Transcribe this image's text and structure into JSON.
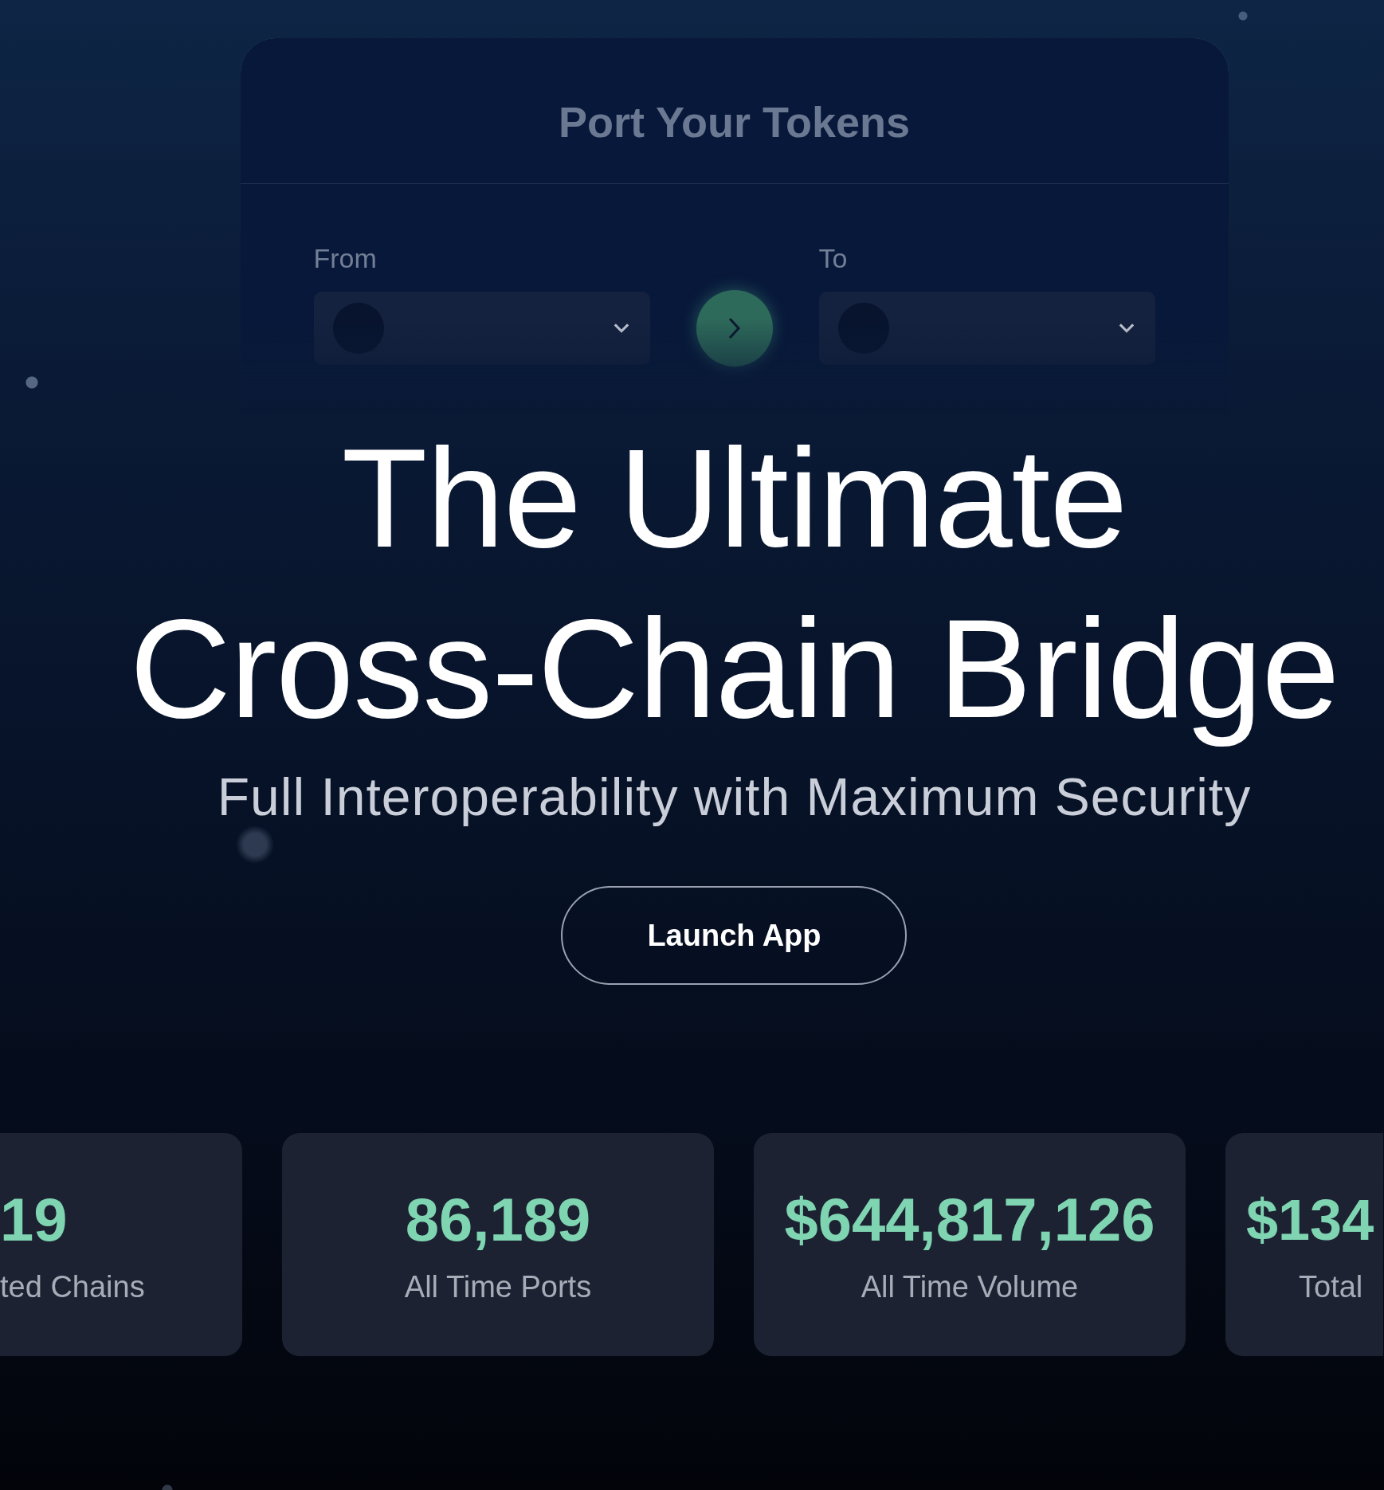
{
  "bridge_widget": {
    "title": "Port Your Tokens",
    "from_label": "From",
    "to_label": "To"
  },
  "hero": {
    "title_lines": [
      "The Ultimate",
      "Cross-Chain Bridge"
    ],
    "subtitle": "Full Interoperability with Maximum Security",
    "button": "Launch App"
  },
  "stats": [
    {
      "kind": "left-edge",
      "value": "19",
      "label": "ted Chains"
    },
    {
      "kind": "full",
      "value": "86,189",
      "label": "All Time Ports"
    },
    {
      "kind": "full",
      "value": "$644,817,126",
      "label": "All Time Volume"
    },
    {
      "kind": "right-edge",
      "value": "$134",
      "label": "Total"
    }
  ]
}
